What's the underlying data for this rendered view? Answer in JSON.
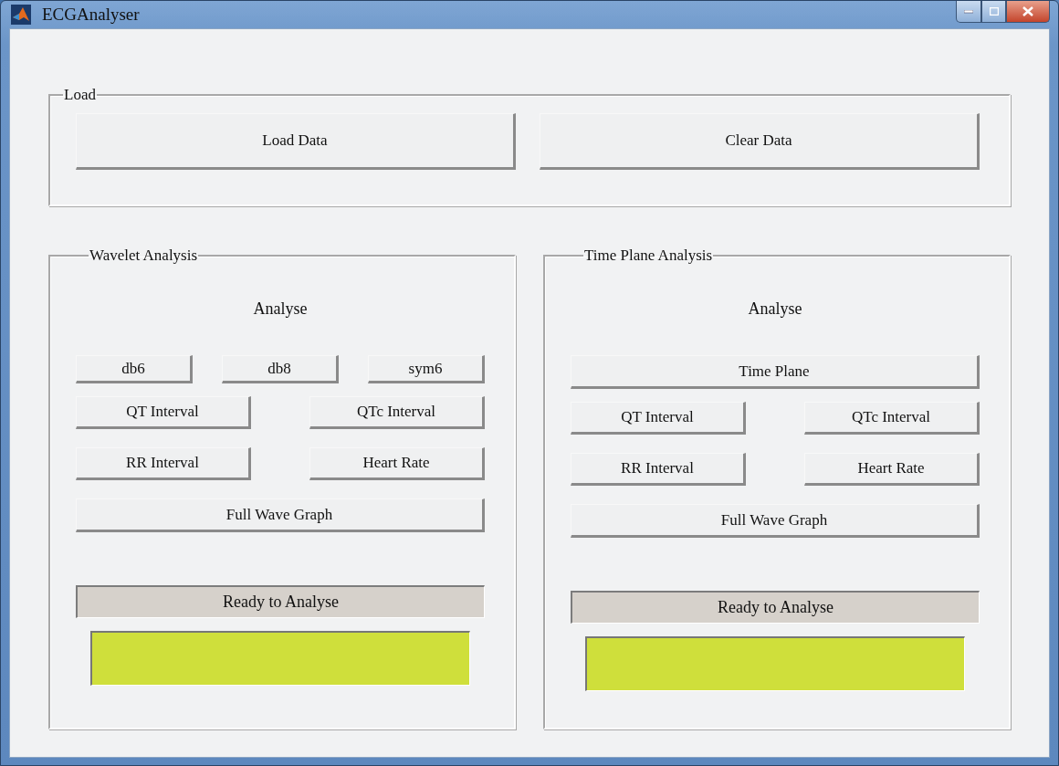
{
  "window": {
    "title": "ECGAnalyser"
  },
  "load_group": {
    "title": "Load",
    "buttons": [
      "Load Data",
      "Clear Data"
    ]
  },
  "panels": [
    {
      "title": "Wavelet Analysis",
      "heading": "Analyse",
      "button_rows": [
        [
          "db6",
          "db8",
          "sym6"
        ],
        [
          "QT Interval",
          "QTc Interval"
        ],
        [
          "RR Interval",
          "Heart Rate"
        ],
        [
          "Full  Wave Graph"
        ]
      ],
      "status": "Ready to Analyse"
    },
    {
      "title": "Time Plane Analysis",
      "heading": "Analyse",
      "button_rows": [
        [
          "Time Plane"
        ],
        [
          "QT Interval",
          "QTc Interval"
        ],
        [
          "RR Interval",
          "Heart Rate"
        ],
        [
          "Full  Wave Graph"
        ]
      ],
      "status": "Ready to Analyse"
    }
  ]
}
